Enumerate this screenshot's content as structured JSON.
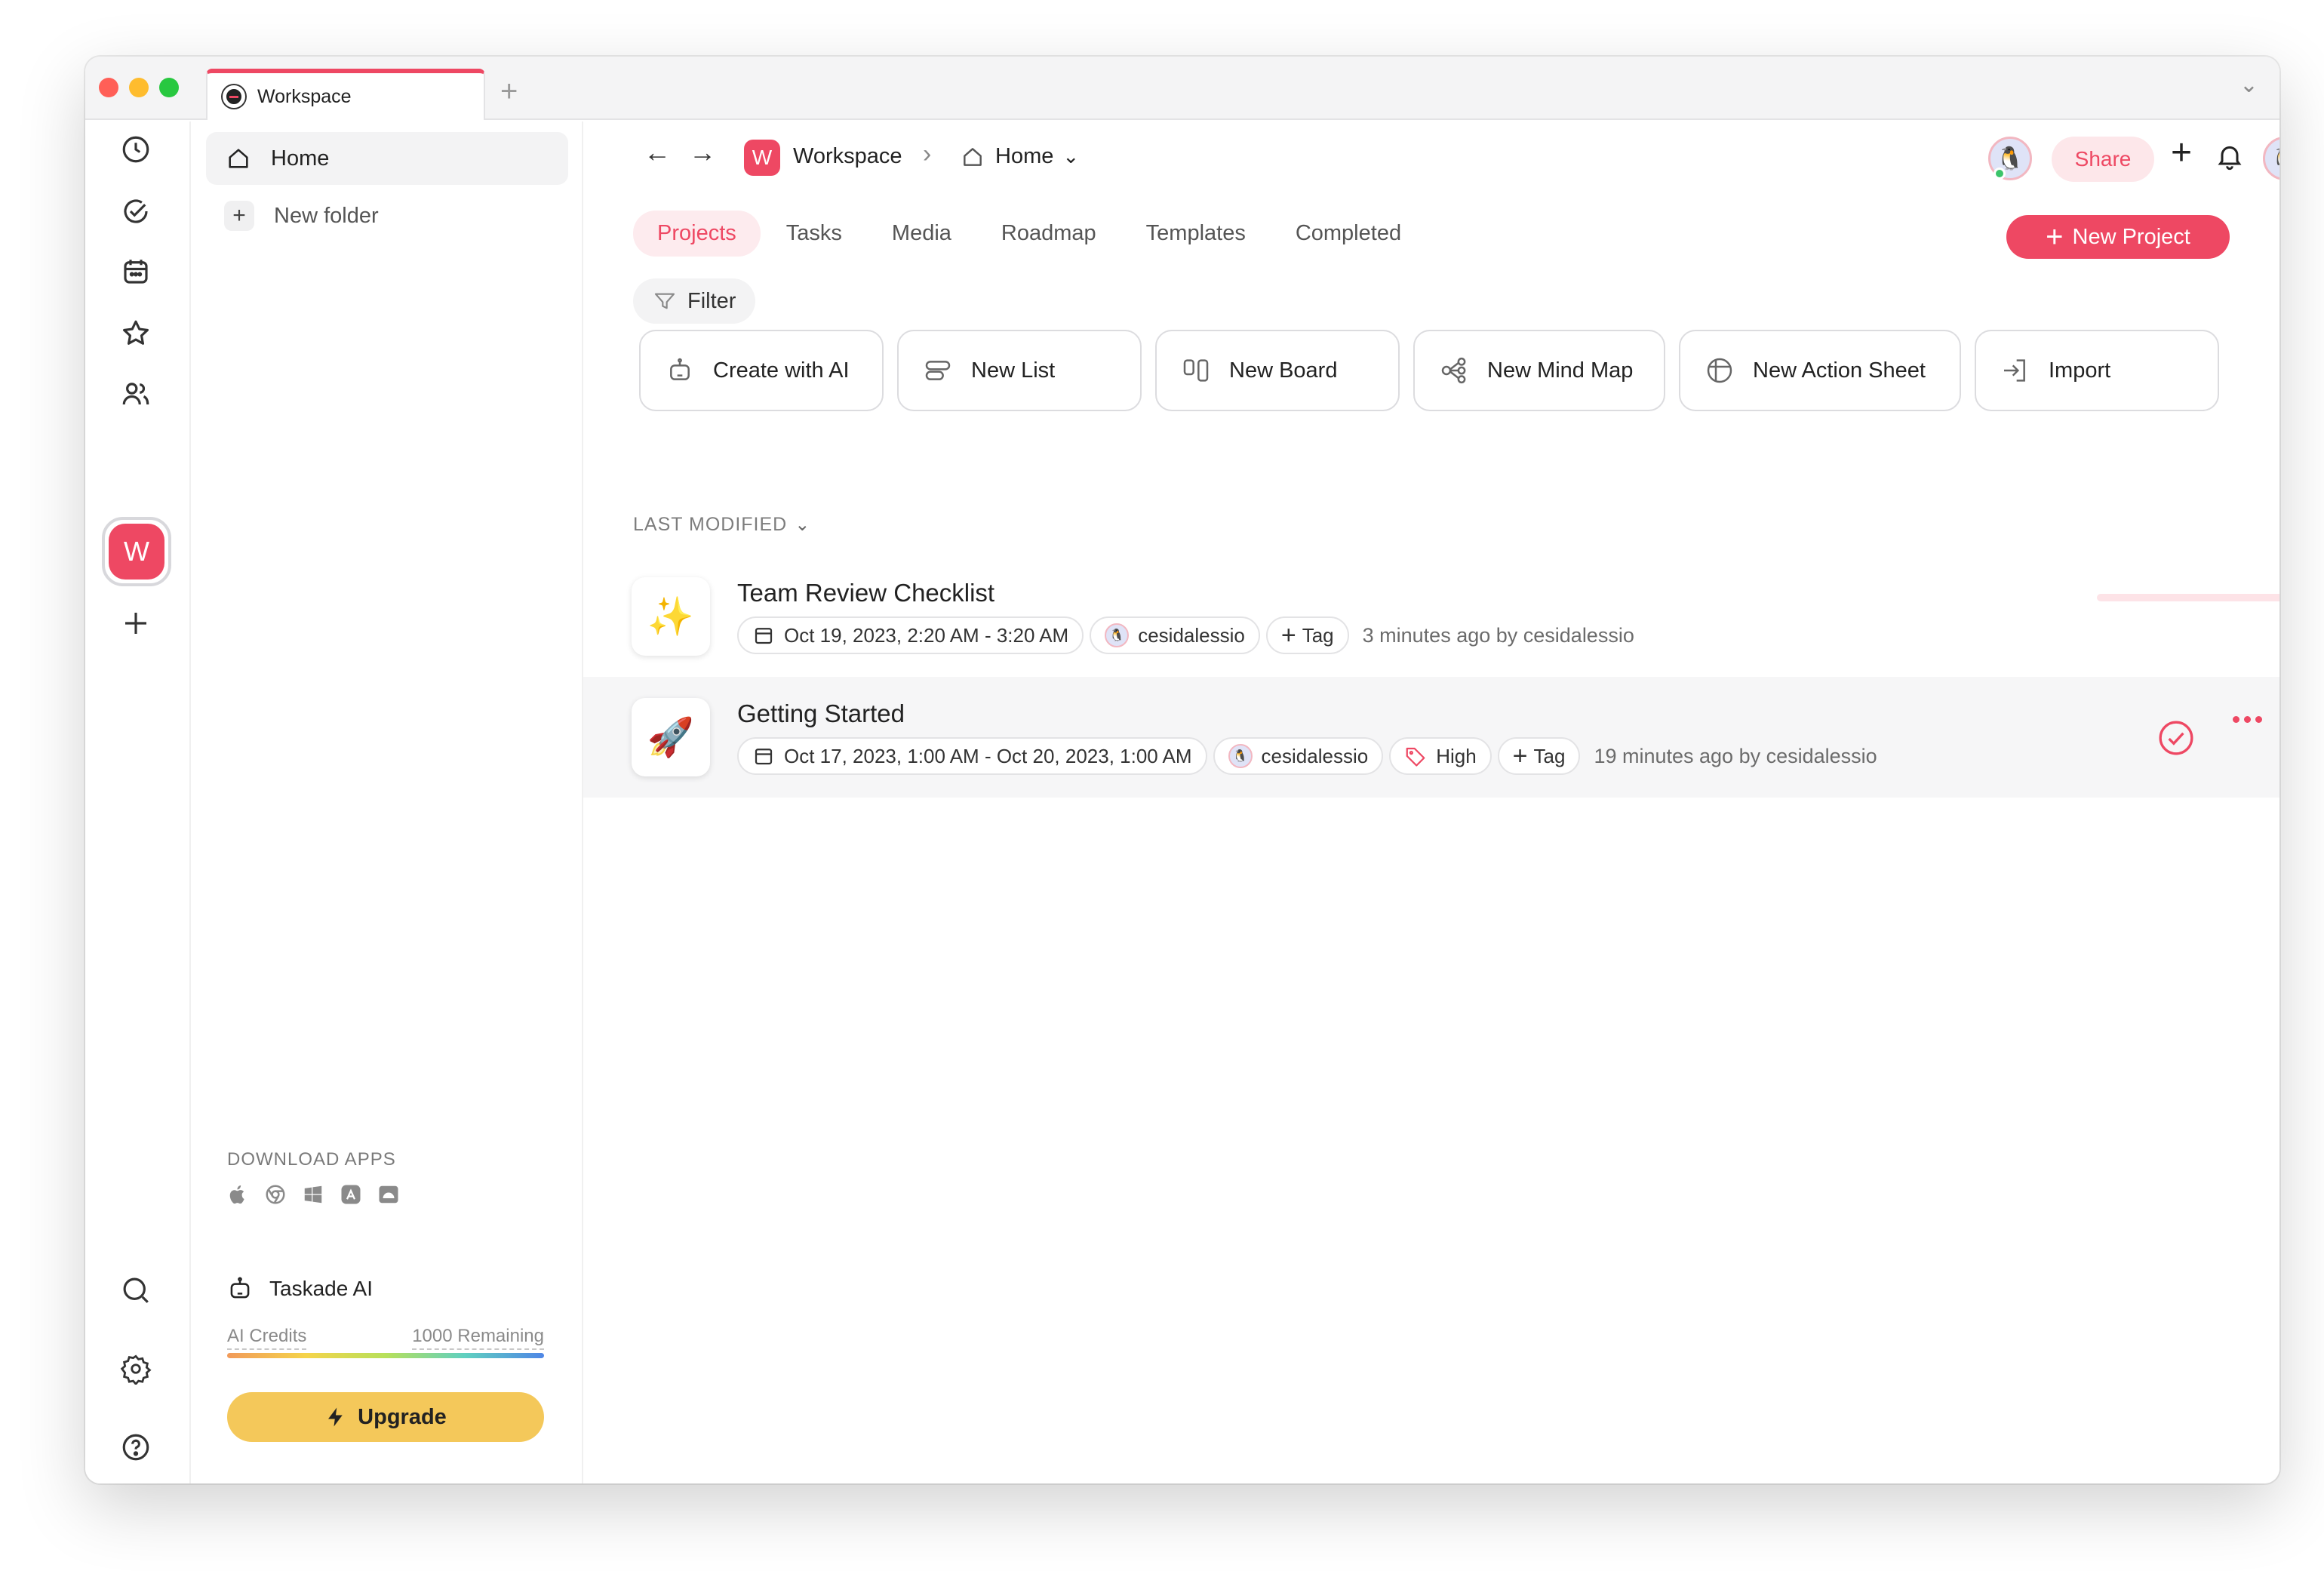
{
  "browser": {
    "tab_title": "Workspace",
    "new_tab": "+",
    "chevron": "⌄"
  },
  "rail": {
    "workspace_initial": "W",
    "icons": [
      "clock-icon",
      "check-circle-icon",
      "calendar-icon",
      "star-icon",
      "users-icon",
      "plus-icon",
      "search-icon",
      "settings-icon",
      "help-icon"
    ]
  },
  "sidebar": {
    "home_label": "Home",
    "new_folder_label": "New folder",
    "download_label": "DOWNLOAD APPS",
    "download_icons": [
      "apple-icon",
      "chrome-icon",
      "windows-icon",
      "app-store-icon",
      "android-icon"
    ],
    "ai_label": "Taskade AI",
    "credits_label": "AI Credits",
    "credits_remaining": "1000 Remaining",
    "upgrade_label": "Upgrade"
  },
  "header": {
    "back": "←",
    "forward": "→",
    "workspace_initial": "W",
    "workspace_name": "Workspace",
    "separator": "›",
    "home_label": "Home",
    "home_chevron": "⌄",
    "share_label": "Share",
    "plus": "+"
  },
  "tabs": [
    {
      "label": "Projects",
      "active": true
    },
    {
      "label": "Tasks"
    },
    {
      "label": "Media"
    },
    {
      "label": "Roadmap"
    },
    {
      "label": "Templates"
    },
    {
      "label": "Completed"
    }
  ],
  "new_project_label": "New Project",
  "filter_label": "Filter",
  "actions": [
    {
      "label": "Create with AI",
      "icon": "robot-icon"
    },
    {
      "label": "New List",
      "icon": "list-icon"
    },
    {
      "label": "New Board",
      "icon": "board-icon"
    },
    {
      "label": "New Mind Map",
      "icon": "mind-map-icon"
    },
    {
      "label": "New Action Sheet",
      "icon": "action-sheet-icon"
    },
    {
      "label": "Import",
      "icon": "import-icon"
    }
  ],
  "sort_label": "LAST MODIFIED",
  "projects": [
    {
      "emoji": "✨",
      "title": "Team Review Checklist",
      "date": "Oct 19, 2023, 2:20 AM - 3:20 AM",
      "user": "cesidalessio",
      "tag_label": "Tag",
      "modified": "3 minutes ago by cesidalessio"
    },
    {
      "emoji": "🚀",
      "title": "Getting Started",
      "date": "Oct 17, 2023, 1:00 AM - Oct 20, 2023, 1:00 AM",
      "user": "cesidalessio",
      "priority": "High",
      "tag_label": "Tag",
      "modified": "19 minutes ago by cesidalessio"
    }
  ],
  "colors": {
    "accent": "#ee4863",
    "accent_soft": "#fdebee",
    "upgrade": "#f4c85a"
  }
}
